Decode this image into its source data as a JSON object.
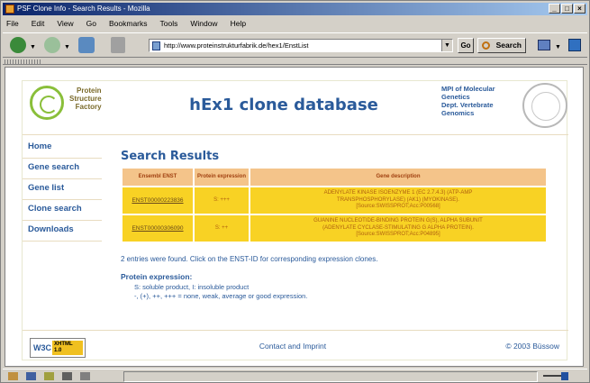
{
  "window": {
    "title": "PSF Clone Info - Search Results - Mozilla"
  },
  "menu": [
    "File",
    "Edit",
    "View",
    "Go",
    "Bookmarks",
    "Tools",
    "Window",
    "Help"
  ],
  "toolbar": {
    "url": "http://www.proteinstrukturfabrik.de/hex1/EnstList",
    "go_label": "Go",
    "search_label": "Search"
  },
  "header": {
    "psf_line1": "Protein",
    "psf_line2": "Structure",
    "psf_line3": "Factory",
    "title": "hEx1 clone database",
    "mpi_line1": "MPI of Molecular",
    "mpi_line2": "Genetics",
    "mpi_line3": "Dept. Vertebrate",
    "mpi_line4": "Genomics"
  },
  "nav": [
    "Home",
    "Gene search",
    "Gene list",
    "Clone search",
    "Downloads"
  ],
  "results": {
    "title": "Search Results",
    "columns": [
      "Ensembl ENST",
      "Protein expression",
      "Gene description"
    ],
    "rows": [
      {
        "enst": "ENST00000223836",
        "expression": "S: +++",
        "desc1": "ADENYLATE KINASE ISOENZYME 1 (EC 2.7.4.3) (ATP-AMP",
        "desc2": "TRANSPHOSPHORYLASE) (AK1) (MYOKINASE).",
        "desc3": "[Source:SWISSPROT;Acc:P00568]"
      },
      {
        "enst": "ENST00000306090",
        "expression": "S: ++",
        "desc1": "GUANINE NUCLEOTIDE-BINDING PROTEIN G(S), ALPHA SUBUNIT",
        "desc2": "(ADENYLATE CYCLASE-STIMULATING G ALPHA PROTEIN).",
        "desc3": "[Source:SWISSPROT;Acc:P04895]"
      }
    ],
    "entries_text": "2 entries were found. Click on the ENST-ID for corresponding expression clones.",
    "pe_title": "Protein expression:",
    "pe_line1": "S: soluble product, I: insoluble product",
    "pe_line2": "-, (+), ++, +++ = none, weak, average or good expression."
  },
  "footer": {
    "w3c": "W3C",
    "xhtml": "XHTML 1.0",
    "contact": "Contact and Imprint",
    "copyright": "© 2003 Büssow"
  }
}
